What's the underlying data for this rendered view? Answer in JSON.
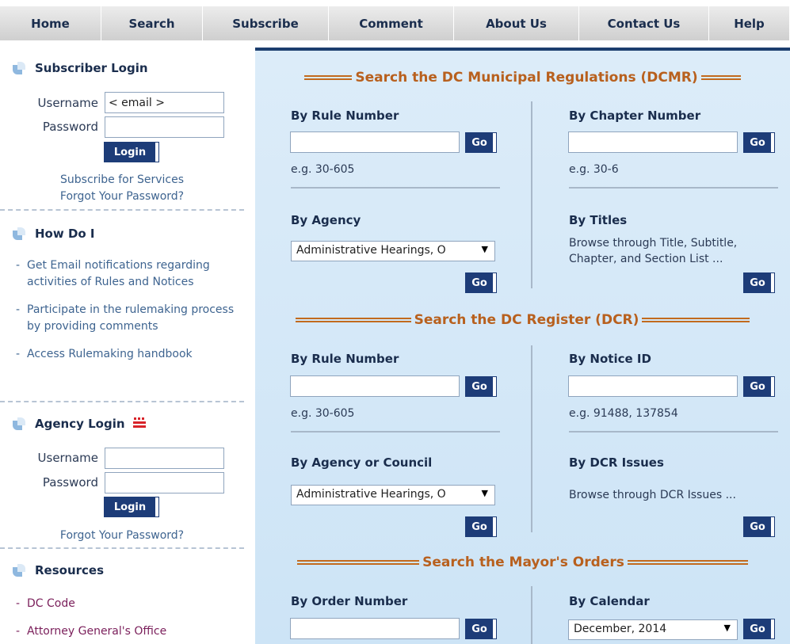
{
  "nav": [
    "Home",
    "Search",
    "Subscribe",
    "Comment",
    "About Us",
    "Contact Us",
    "Help"
  ],
  "subscriber_login": {
    "title": "Subscriber Login",
    "username_label": "Username",
    "username_value": "< email >",
    "password_label": "Password",
    "login_label": "Login",
    "subscribe_link": "Subscribe for Services",
    "forgot_link": "Forgot Your Password?"
  },
  "how_do_i": {
    "title": "How Do I",
    "items": [
      "Get Email notifications regarding activities of Rules and Notices",
      "Participate in the rulemaking process by providing comments",
      "Access Rulemaking handbook"
    ]
  },
  "agency_login": {
    "title": "Agency Login",
    "username_label": "Username",
    "password_label": "Password",
    "login_label": "Login",
    "forgot_link": "Forgot Your Password?"
  },
  "resources": {
    "title": "Resources",
    "items": [
      "DC Code",
      "Attorney General's Office"
    ]
  },
  "dcmr": {
    "title": "Search the DC Municipal Regulations (DCMR)",
    "by_rule": "By Rule Number",
    "rule_hint": "e.g. 30-605",
    "by_chapter": "By Chapter Number",
    "chapter_hint": "e.g. 30-6",
    "by_agency": "By Agency",
    "agency_value": "Administrative Hearings, O",
    "by_titles": "By Titles",
    "titles_desc": "Browse through Title, Subtitle, Chapter, and Section List ..."
  },
  "dcr": {
    "title": "Search the DC Register (DCR)",
    "by_rule": "By Rule Number",
    "rule_hint": "e.g. 30-605",
    "by_notice": "By Notice ID",
    "notice_hint": "e.g. 91488, 137854",
    "by_agency": "By Agency or Council",
    "agency_value": "Administrative Hearings, O",
    "by_issues": "By DCR Issues",
    "issues_desc": "Browse through DCR Issues ..."
  },
  "mayors": {
    "title": "Search the Mayor's Orders",
    "by_order": "By Order Number",
    "by_calendar": "By Calendar",
    "calendar_value": "December, 2014"
  },
  "go_label": "Go"
}
